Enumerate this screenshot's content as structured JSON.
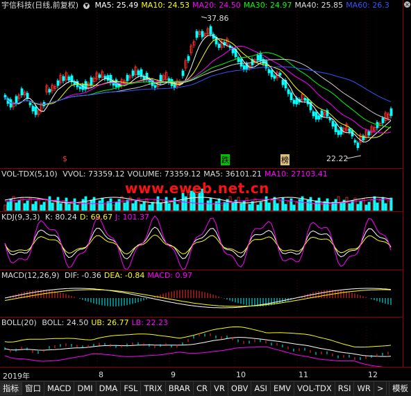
{
  "colors": {
    "white": "#ffffff",
    "yellow": "#ffff00",
    "magenta": "#ff00ff",
    "green": "#00ff00",
    "blue": "#3355ff",
    "up": "#ff3030",
    "down": "#00ffff"
  },
  "main": {
    "title": "宇信科技(日线,前复权)",
    "indicators": [
      {
        "label": "MA5: 25.49",
        "color": "#ffffff"
      },
      {
        "label": "MA10: 24.53",
        "color": "#ffff00"
      },
      {
        "label": "MA20: 24.50",
        "color": "#ff00ff"
      },
      {
        "label": "MA30: 24.97",
        "color": "#00ff00"
      },
      {
        "label": "MA40: 25.85",
        "color": "#dddddd"
      },
      {
        "label": "MA60: 26.3",
        "color": "#3355ff"
      }
    ],
    "high_label": "37.86",
    "low_label": "22.22",
    "marks": [
      "$",
      "跌",
      "榜"
    ]
  },
  "vol": {
    "title": "VOL-TDX(5,10)",
    "items": [
      {
        "label": "VVOL: 73359.12",
        "color": "#dddddd"
      },
      {
        "label": "VOLUME: 73359.12",
        "color": "#dddddd"
      },
      {
        "label": "MA5: 36101.21",
        "color": "#dddddd"
      },
      {
        "label": "MA10: 27103.41",
        "color": "#ff00ff"
      }
    ]
  },
  "watermark": "www.eweb.net.cn",
  "kdj": {
    "title": "KDJ(9,3,3)",
    "items": [
      {
        "label": "K: 80.24",
        "color": "#dddddd"
      },
      {
        "label": "D: 69.67",
        "color": "#ffff00"
      },
      {
        "label": "J: 101.37",
        "color": "#ff00ff"
      }
    ]
  },
  "macd": {
    "title": "MACD(12,26,9)",
    "items": [
      {
        "label": "DIF: -0.36",
        "color": "#dddddd"
      },
      {
        "label": "DEA: -0.84",
        "color": "#ffff00"
      },
      {
        "label": "MACD: 0.97",
        "color": "#ff00ff"
      }
    ]
  },
  "boll": {
    "title": "BOLL(20)",
    "items": [
      {
        "label": "BOLL: 24.50",
        "color": "#dddddd"
      },
      {
        "label": "UB: 26.77",
        "color": "#ffff00"
      },
      {
        "label": "LB: 22.23",
        "color": "#ff00ff"
      }
    ]
  },
  "xaxis": [
    "2019年",
    "8",
    "9",
    "10",
    "11",
    "12"
  ],
  "tabs": [
    "指标",
    "窗口",
    "MACD",
    "DMI",
    "DMA",
    "FSL",
    "TRIX",
    "BRAR",
    "CR",
    "VR",
    "OBV",
    "ASI",
    "EMV",
    "VOL-TDX",
    "RSI",
    "WR",
    ">"
  ],
  "tab_right": "模板"
}
